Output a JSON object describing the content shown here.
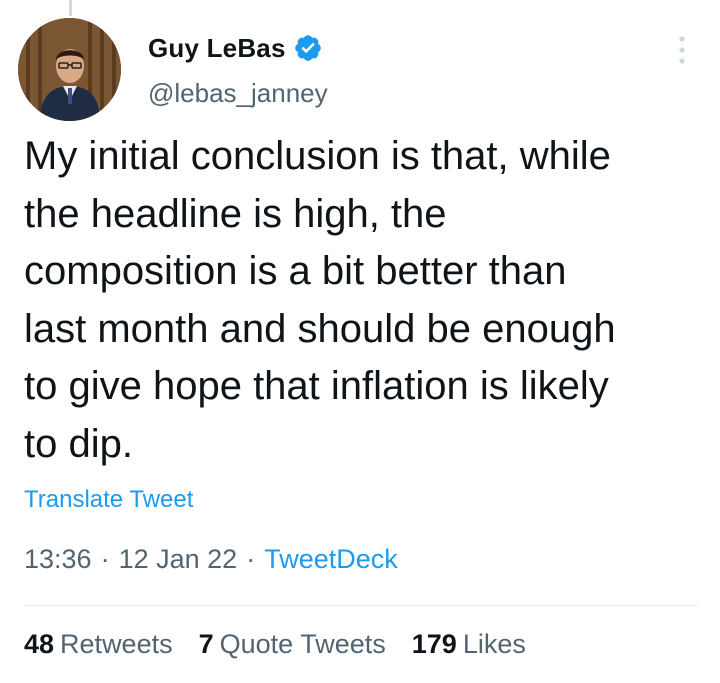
{
  "tweet": {
    "author": {
      "display_name": "Guy LeBas",
      "handle": "@lebas_janney",
      "verified": true,
      "avatar_icon": "user-avatar"
    },
    "text": "My initial conclusion is that, while\nthe headline is high, the\ncomposition is a bit better than\nlast month and should be enough\nto give hope that inflation is likely\nto dip.",
    "translate_label": "Translate Tweet",
    "time": "13:36",
    "date": "12 Jan 22",
    "separator": "·",
    "source": "TweetDeck",
    "stats": {
      "retweets_count": "48",
      "retweets_label": "Retweets",
      "quotes_count": "7",
      "quotes_label": "Quote Tweets",
      "likes_count": "179",
      "likes_label": "Likes"
    }
  },
  "colors": {
    "accent": "#1d9bf0",
    "text_primary": "#0f1419",
    "text_secondary": "#536471"
  }
}
